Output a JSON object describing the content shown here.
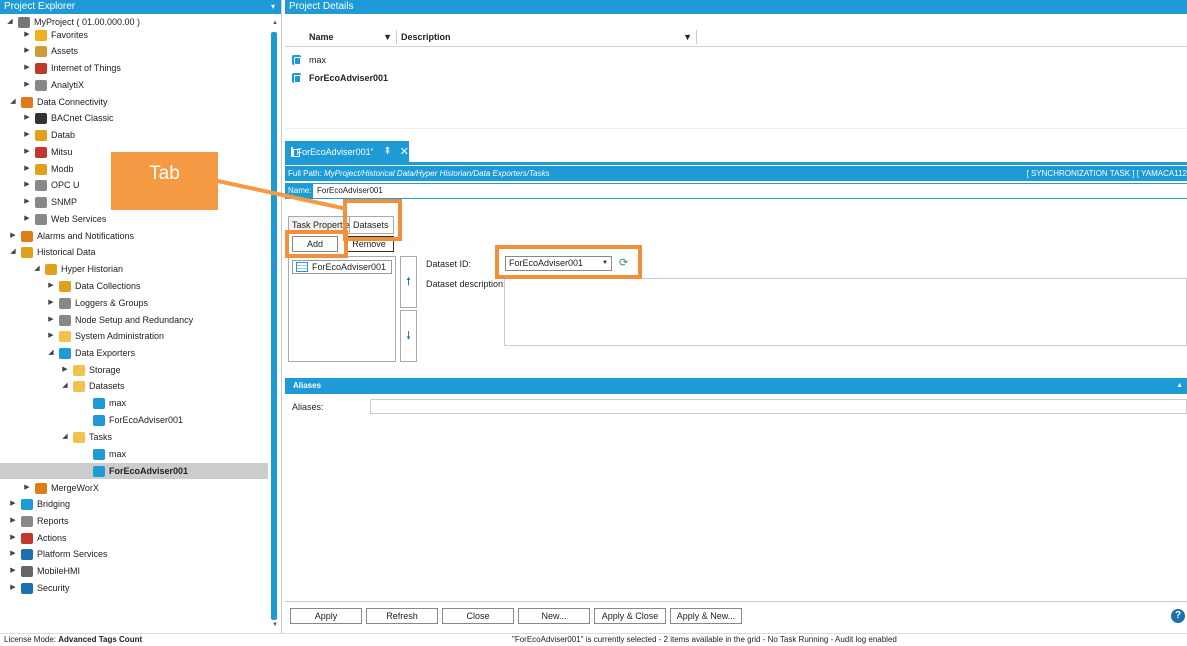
{
  "explorer": {
    "title": "Project Explorer",
    "tree": [
      {
        "label": "MyProject ( 01.00.000.00 )",
        "toggle": "◢",
        "icon": "project-icon",
        "color": "#777"
      },
      {
        "label": "Favorites",
        "toggle": "▶",
        "icon": "star-icon",
        "color": "#f2b01e"
      },
      {
        "label": "Assets",
        "toggle": "▶",
        "icon": "assets-icon",
        "color": "#d09a3a"
      },
      {
        "label": "Internet of Things",
        "toggle": "▶",
        "icon": "iot-icon",
        "color": "#c0392b"
      },
      {
        "label": "AnalytiX",
        "toggle": "▶",
        "icon": "analytix-icon",
        "color": "#888"
      },
      {
        "label": "Data Connectivity",
        "toggle": "◢",
        "icon": "connectivity-icon",
        "color": "#e07b1a"
      },
      {
        "label": "BACnet Classic",
        "toggle": "▶",
        "icon": "bacnet-icon",
        "color": "#333"
      },
      {
        "label": "Datab",
        "toggle": "▶",
        "icon": "database-icon",
        "color": "#e0a21a"
      },
      {
        "label": "Mitsu",
        "toggle": "▶",
        "icon": "mitsubishi-icon",
        "color": "#c0392b"
      },
      {
        "label": "Modb",
        "toggle": "▶",
        "icon": "modbus-icon",
        "color": "#e0a21a"
      },
      {
        "label": "OPC U",
        "toggle": "▶",
        "icon": "opc-icon",
        "color": "#888"
      },
      {
        "label": "SNMP",
        "toggle": "▶",
        "icon": "snmp-icon",
        "color": "#888"
      },
      {
        "label": "Web Services",
        "toggle": "▶",
        "icon": "web-services-icon",
        "color": "#888"
      },
      {
        "label": "Alarms and Notifications",
        "toggle": "▶",
        "icon": "alarm-icon",
        "color": "#e07b1a"
      },
      {
        "label": "Historical Data",
        "toggle": "◢",
        "icon": "historical-icon",
        "color": "#e0a21a"
      },
      {
        "label": "Hyper Historian",
        "toggle": "◢",
        "icon": "hyper-historian-icon",
        "color": "#e0a21a"
      },
      {
        "label": "Data Collections",
        "toggle": "▶",
        "icon": "collections-icon",
        "color": "#e0a21a"
      },
      {
        "label": "Loggers & Groups",
        "toggle": "▶",
        "icon": "loggers-icon",
        "color": "#888"
      },
      {
        "label": "Node Setup and Redundancy",
        "toggle": "▶",
        "icon": "node-icon",
        "color": "#888"
      },
      {
        "label": "System Administration",
        "toggle": "▶",
        "icon": "folder-icon",
        "color": "#f2c14e"
      },
      {
        "label": "Data Exporters",
        "toggle": "◢",
        "icon": "exporters-icon",
        "color": "#1e9ad6"
      },
      {
        "label": "Storage",
        "toggle": "▶",
        "icon": "folder-icon",
        "color": "#f2c14e"
      },
      {
        "label": "Datasets",
        "toggle": "◢",
        "icon": "folder-icon",
        "color": "#f2c14e"
      },
      {
        "label": "max",
        "toggle": "",
        "icon": "table-icon",
        "color": "#1e9ad6"
      },
      {
        "label": "ForEcoAdviser001",
        "toggle": "",
        "icon": "table-icon",
        "color": "#1e9ad6"
      },
      {
        "label": "Tasks",
        "toggle": "◢",
        "icon": "folder-icon",
        "color": "#f2c14e"
      },
      {
        "label": "max",
        "toggle": "",
        "icon": "task-icon",
        "color": "#1e9ad6"
      },
      {
        "label": "ForEcoAdviser001",
        "toggle": "",
        "icon": "task-icon",
        "color": "#1e9ad6"
      },
      {
        "label": "MergeWorX",
        "toggle": "▶",
        "icon": "mergeworx-icon",
        "color": "#e07b1a"
      },
      {
        "label": "Bridging",
        "toggle": "▶",
        "icon": "bridging-icon",
        "color": "#1e9ad6"
      },
      {
        "label": "Reports",
        "toggle": "▶",
        "icon": "reports-icon",
        "color": "#888"
      },
      {
        "label": "Actions",
        "toggle": "▶",
        "icon": "actions-icon",
        "color": "#c0392b"
      },
      {
        "label": "Platform Services",
        "toggle": "▶",
        "icon": "platform-icon",
        "color": "#1e6fb0"
      },
      {
        "label": "MobileHMI",
        "toggle": "▶",
        "icon": "mobile-icon",
        "color": "#666"
      },
      {
        "label": "Security",
        "toggle": "▶",
        "icon": "security-icon",
        "color": "#1e6fb0"
      }
    ]
  },
  "details": {
    "title": "Project Details",
    "columns": [
      "Name",
      "Description"
    ],
    "rows": [
      "max",
      "ForEcoAdviser001"
    ]
  },
  "doc_tab": {
    "label": "ForEcoAdviser001",
    "modified": "*"
  },
  "full_path": {
    "label": "Full Path:",
    "value": "MyProject/Historical Data/Hyper Historian/Data Exporters/Tasks",
    "right": "[ SYNCHRONIZATION TASK ] [ YAMACA112"
  },
  "name_row": {
    "label": "Name:",
    "value": "ForEcoAdviser001"
  },
  "tabs": {
    "task_properties": "Task Properties",
    "datasets": "Datasets"
  },
  "dataset_buttons": {
    "add": "Add",
    "remove": "Remove"
  },
  "dataset_list": [
    "ForEcoAdviser001"
  ],
  "dataset_form": {
    "id_label": "Dataset ID:",
    "id_value": "ForEcoAdviser001",
    "desc_label": "Dataset description:"
  },
  "aliases": {
    "header": "Aliases",
    "label": "Aliases:"
  },
  "bottom_buttons": {
    "apply": "Apply",
    "refresh": "Refresh",
    "close": "Close",
    "new": "New...",
    "apply_close": "Apply & Close",
    "apply_new": "Apply & New..."
  },
  "callout": {
    "text": "Tab"
  },
  "status": {
    "license_label": "License Mode: ",
    "license_value": "Advanced Tags Count",
    "message": "\"ForEcoAdviser001\" is currently selected - 2 items available in the grid - No Task Running - Audit log enabled"
  },
  "colors": {
    "accent": "#1e9ad6",
    "highlight": "#f0903a"
  }
}
